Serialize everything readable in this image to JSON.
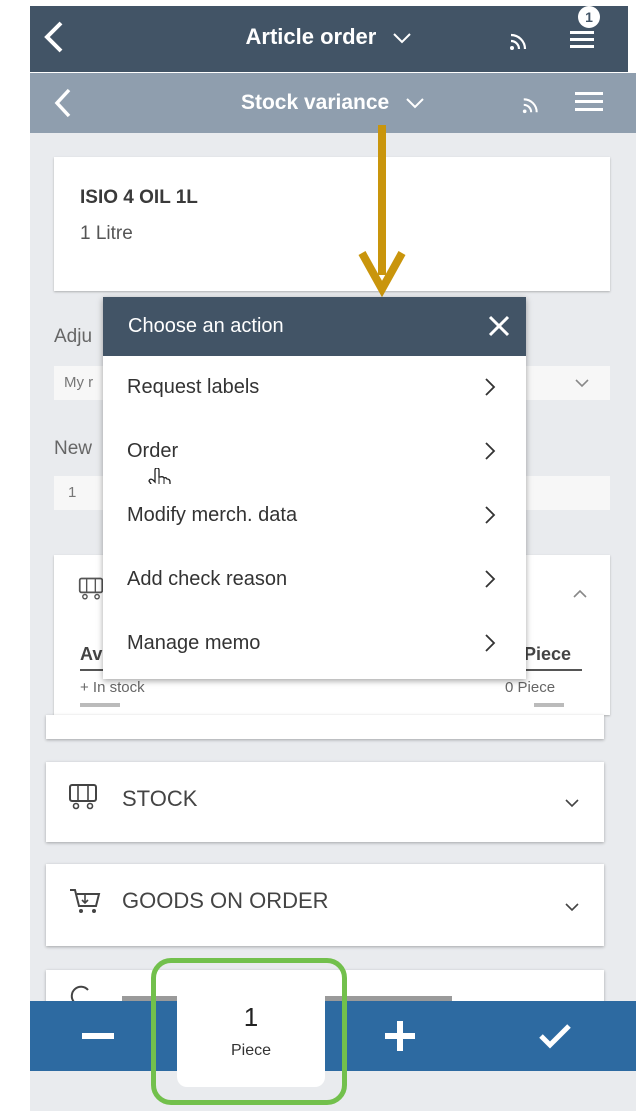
{
  "top_bar": {
    "title": "Article order",
    "badge": "1"
  },
  "second_bar": {
    "title": "Stock variance"
  },
  "article": {
    "name": "ISIO 4 OIL 1L",
    "unit": "1 Litre"
  },
  "fields": {
    "adjust_label": "Adju",
    "adjust_value": "My r",
    "new_label": "New",
    "new_value": "1"
  },
  "availability": {
    "header_left": "Av",
    "header_right": "Piece",
    "row1_label": "+ In stock",
    "row1_value": "0 Piece"
  },
  "sections": [
    {
      "label": "STOCK"
    },
    {
      "label": "GOODS ON ORDER"
    }
  ],
  "popup": {
    "title": "Choose an action",
    "items": [
      {
        "label": "Request labels"
      },
      {
        "label": "Order"
      },
      {
        "label": "Modify merch. data"
      },
      {
        "label": "Add check reason"
      },
      {
        "label": "Manage memo"
      }
    ]
  },
  "bottom_bar": {
    "quantity": "1",
    "unit": "Piece"
  },
  "colors": {
    "header": "#425466",
    "subheader": "#8f9eae",
    "bottom_bar": "#2d6aa1",
    "highlight": "#72c04c",
    "arrow": "#c9950c"
  }
}
